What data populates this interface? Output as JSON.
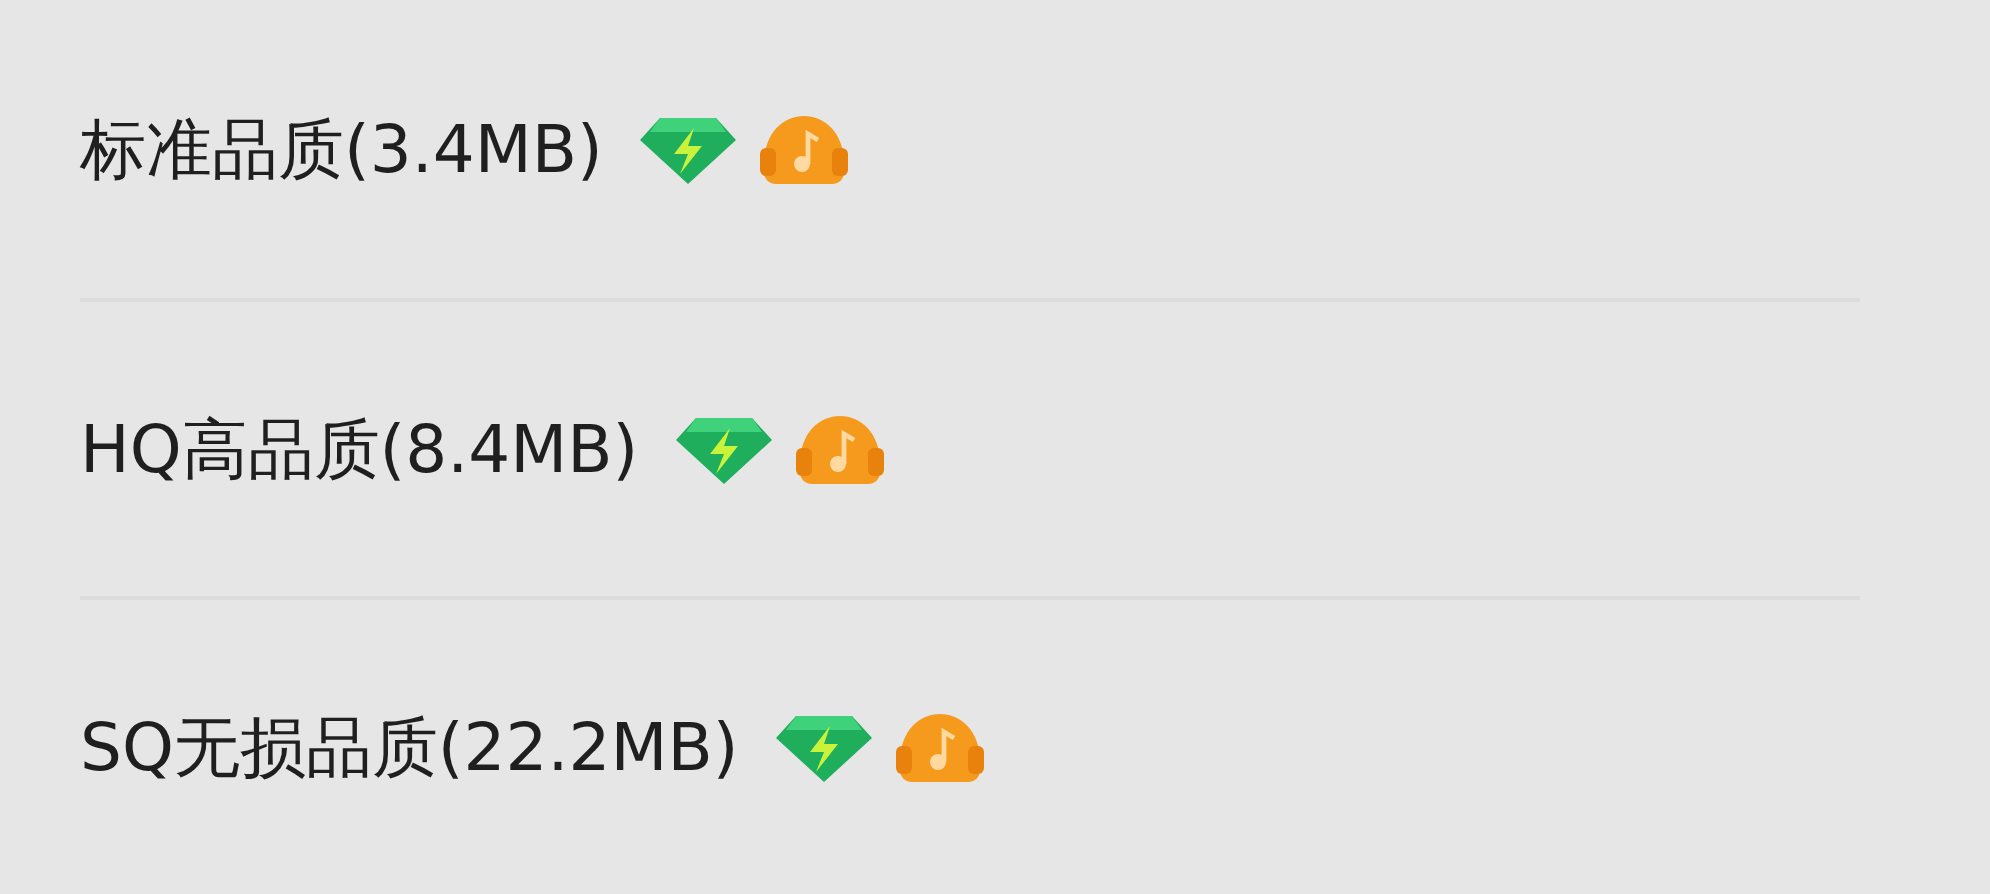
{
  "quality_options": [
    {
      "label": "标准品质(3.4MB)"
    },
    {
      "label": "HQ高品质(8.4MB)"
    },
    {
      "label": "SQ无损品质(22.2MB)"
    }
  ]
}
